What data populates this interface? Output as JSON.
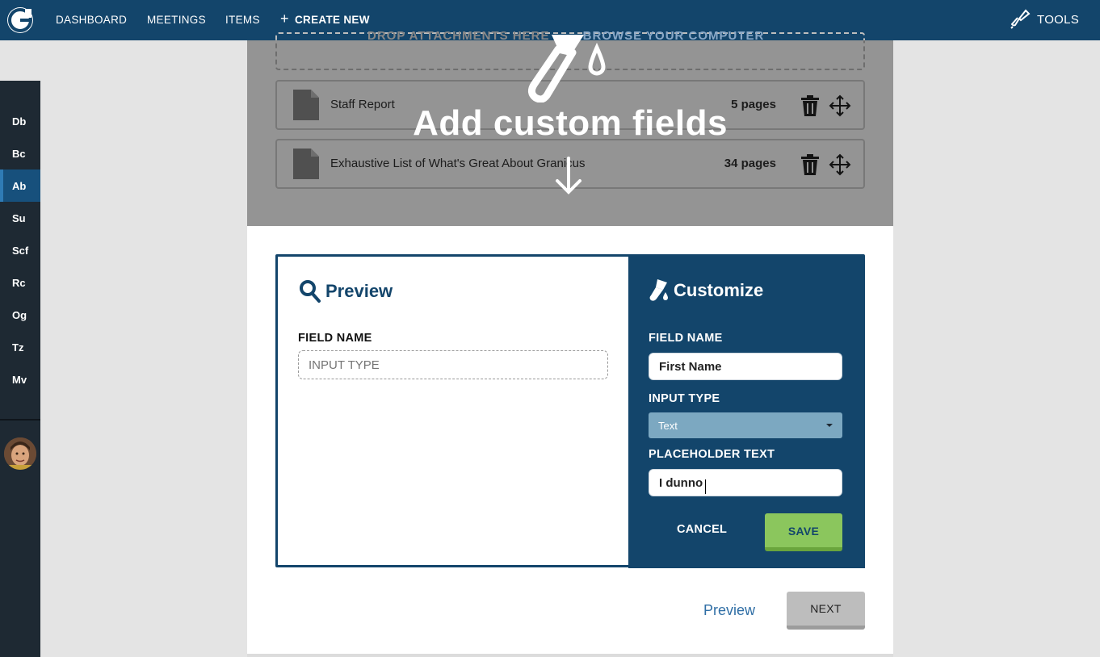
{
  "nav": {
    "dashboard": "DASHBOARD",
    "meetings": "MEETINGS",
    "items": "ITEMS",
    "create_new": "CREATE NEW",
    "tools": "TOOLS"
  },
  "sidebar": {
    "items": [
      {
        "label": "Db",
        "active": false
      },
      {
        "label": "Bc",
        "active": false
      },
      {
        "label": "Ab",
        "active": true
      },
      {
        "label": "Su",
        "active": false
      },
      {
        "label": "Scf",
        "active": false
      },
      {
        "label": "Rc",
        "active": false
      },
      {
        "label": "Og",
        "active": false
      },
      {
        "label": "Tz",
        "active": false
      },
      {
        "label": "Mv",
        "active": false
      }
    ]
  },
  "attachments": {
    "dropzone_text": "DROP ATTACHMENTS HERE",
    "dropzone_link": "BROWSE YOUR COMPUTER",
    "files": [
      {
        "title": "Staff Report",
        "pages": "5 pages"
      },
      {
        "title": "Exhaustive List of What's Great About Granicus",
        "pages": "34 pages"
      }
    ]
  },
  "tip": {
    "title": "Add custom fields"
  },
  "preview": {
    "heading": "Preview",
    "field_label": "FIELD NAME",
    "input_placeholder": "INPUT TYPE"
  },
  "customize": {
    "heading": "Customize",
    "field_name_label": "FIELD NAME",
    "field_name_value": "First Name",
    "input_type_label": "INPUT TYPE",
    "input_type_value": "Text",
    "placeholder_label": "PLACEHOLDER TEXT",
    "placeholder_value": "I dunno",
    "cancel": "CANCEL",
    "save": "SAVE"
  },
  "footer": {
    "preview_link": "Preview",
    "next": "NEXT"
  },
  "colors": {
    "nav_bg": "#13456b",
    "sidebar_bg": "#1e2933",
    "save_green": "#8bc65d",
    "select_blue": "#7ca8c1"
  }
}
